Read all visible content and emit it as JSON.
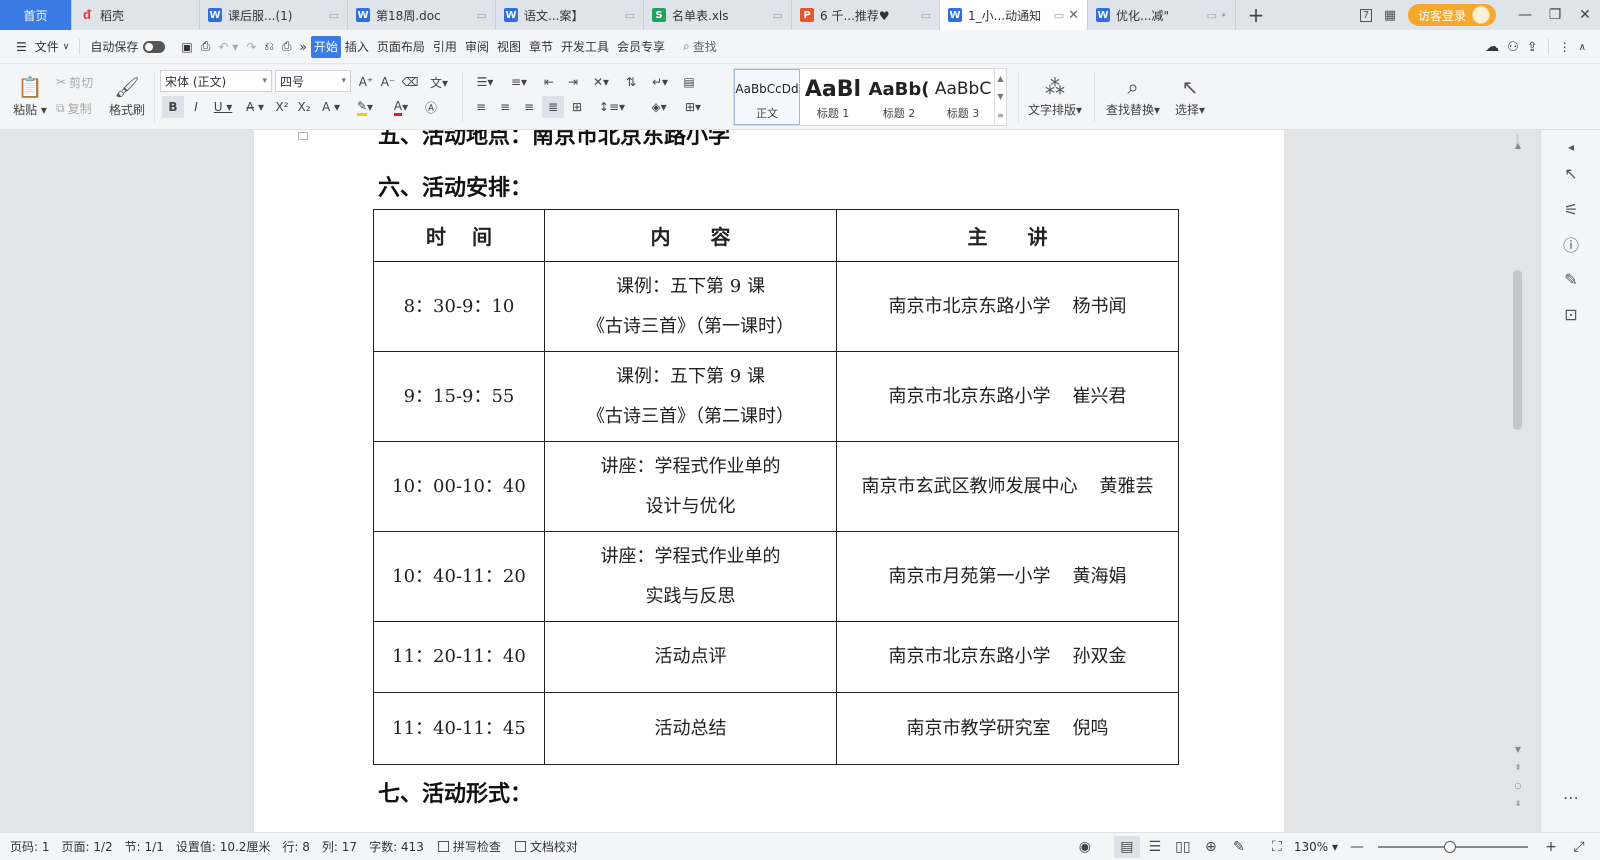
{
  "tabs": [
    {
      "label": "首页",
      "kind": "home"
    },
    {
      "label": "稻壳",
      "icon": "daoke-icon"
    },
    {
      "label": "课后服...(1)",
      "icon": "W"
    },
    {
      "label": "第18周.doc",
      "icon": "W"
    },
    {
      "label": "语文...案】",
      "icon": "W"
    },
    {
      "label": "名单表.xls",
      "icon": "S"
    },
    {
      "label": "6 千...推荐♥",
      "icon": "P"
    },
    {
      "label": "1_小...动通知",
      "icon": "W",
      "active": true
    },
    {
      "label": "优化...减\"",
      "icon": "W"
    }
  ],
  "titlebar": {
    "login_label": "访客登录",
    "badge_count": "7"
  },
  "menubar": {
    "file_label": "文件",
    "autosave_label": "自动保存",
    "items": [
      "开始",
      "插入",
      "页面布局",
      "引用",
      "审阅",
      "视图",
      "章节",
      "开发工具",
      "会员专享"
    ],
    "search_label": "查找"
  },
  "ribbon": {
    "paste": "粘贴",
    "cut": "剪切",
    "copy": "复制",
    "format_painter": "格式刷",
    "font_name": "宋体 (正文)",
    "font_size": "四号",
    "styles": [
      {
        "preview": "AaBbCcDd",
        "name": "正文",
        "selected": true
      },
      {
        "preview": "AaBl",
        "name": "标题 1"
      },
      {
        "preview": "AaBb(",
        "name": "标题 2"
      },
      {
        "preview": "AaBbC",
        "name": "标题 3"
      }
    ],
    "text_layout": "文字排版",
    "find_replace": "查找替换",
    "select": "选择"
  },
  "document": {
    "heading_cut": "五、活动地点：南京市北京东路小学",
    "heading_6": "六、活动安排：",
    "heading_7": "七、活动形式：",
    "table": {
      "headers": [
        "时",
        "间",
        "内",
        "容",
        "主",
        "讲"
      ],
      "rows": [
        {
          "time": "8：30-9：10",
          "content_1": "课例：五下第 9 课",
          "content_2": "《古诗三首》（第一课时）",
          "org": "南京市北京东路小学",
          "person": "杨书闻"
        },
        {
          "time": "9：15-9：55",
          "content_1": "课例：五下第 9 课",
          "content_2": "《古诗三首》（第二课时）",
          "org": "南京市北京东路小学",
          "person": "崔兴君"
        },
        {
          "time": "10：00-10：40",
          "content_1": "讲座：学程式作业单的",
          "content_2": "设计与优化",
          "org": "南京市玄武区教师发展中心",
          "person": "黄雅芸"
        },
        {
          "time": "10：40-11：20",
          "content_1": "讲座：学程式作业单的",
          "content_2": "实践与反思",
          "org": "南京市月苑第一小学",
          "person": "黄海娟"
        },
        {
          "time": "11：20-11：40",
          "content_1": "活动点评",
          "content_2": "",
          "org": "南京市北京东路小学",
          "person": "孙双金"
        },
        {
          "time": "11：40-11：45",
          "content_1": "活动总结",
          "content_2": "",
          "org": "南京市教学研究室",
          "person": "倪鸣"
        }
      ]
    }
  },
  "statusbar": {
    "page_num": "页码: 1",
    "pages": "页面: 1/2",
    "section": "节: 1/1",
    "setting": "设置值: 10.2厘米",
    "row": "行: 8",
    "col": "列: 17",
    "words": "字数: 413",
    "spellcheck": "拼写检查",
    "doc_check": "文档校对",
    "zoom": "130%"
  },
  "colors": {
    "accent": "#3a7be6",
    "login": "#f7a82c"
  }
}
